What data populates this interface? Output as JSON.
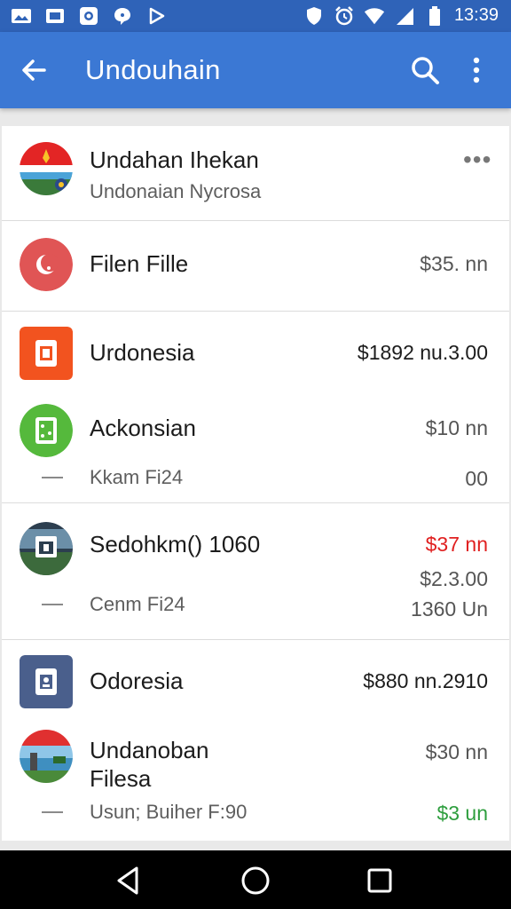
{
  "status_bar": {
    "time": "13:39",
    "left_icons": [
      "photo-icon",
      "screen-icon",
      "camera-icon",
      "chat-icon",
      "play-icon"
    ],
    "right_icons": [
      "shield-icon",
      "alarm-icon",
      "wifi-icon",
      "signal-icon",
      "battery-icon"
    ]
  },
  "app_bar": {
    "title": "Undouhain",
    "color": "#3b78d4"
  },
  "items": [
    {
      "title": "Undahan Ihekan",
      "subtitle": "Undonaian Nycrosa",
      "icon": "flag-avatar-icon"
    },
    {
      "title": "Filen Fille",
      "amount": "$35. nn",
      "icon": "red-circle-icon"
    },
    {
      "title": "Urdonesia",
      "amount": "$1892 nu.3.00",
      "icon": "orange-document-icon"
    },
    {
      "title": "Ackonsian",
      "amount": "$10  nn",
      "sub_label": "Kkam Fi24",
      "sub_value": "00",
      "icon": "green-calculator-icon"
    },
    {
      "title": "Sedohkm() 1060",
      "amount": "$37 nn",
      "amount2": "$2.3.00",
      "sub_label": "Cenm Fi24",
      "sub_value": "1360  Un",
      "icon": "landscape-avatar-icon"
    },
    {
      "title": "Odoresia",
      "amount": "$880 nn.2910",
      "icon": "blue-document-icon"
    },
    {
      "title": "Undanoban",
      "title2": "Filesa",
      "amount": "$30  nn",
      "sub_label": "Usun; Buiher F:90",
      "sub_value": "$3 un",
      "icon": "lake-avatar-icon"
    }
  ],
  "colors": {
    "accent": "#3b78d4",
    "negative": "#e02020",
    "positive": "#2e9e3e"
  }
}
